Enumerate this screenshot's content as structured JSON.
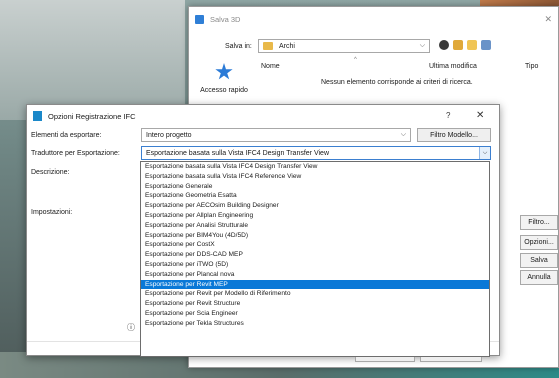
{
  "save_dialog": {
    "title": "Salva 3D",
    "save_in_label": "Salva in:",
    "save_in_value": "Archi",
    "quick_access": "Accesso rapido",
    "columns": [
      "Nome",
      "Ultima modifica",
      "Tipo"
    ],
    "empty_message": "Nessun elemento corrisponde ai criteri di ricerca.",
    "side_buttons": [
      "Filtro...",
      "Opzioni...",
      "Salva",
      "Annulla"
    ],
    "bottom_buttons": [
      "Annulla",
      "OK"
    ]
  },
  "ifc_dialog": {
    "title": "Opzioni Registrazione IFC",
    "help": "?",
    "close": "✕",
    "elements_label": "Elementi da esportare:",
    "elements_value": "Intero progetto",
    "filter_button": "Filtro Modello...",
    "translator_label": "Traduttore per Esportazione:",
    "translator_value": "Esportazione basata sulla Vista IFC4 Design Transfer View",
    "description_label": "Descrizione:",
    "settings_label": "Impostazioni:",
    "info_icon": "ⓘ"
  },
  "dropdown": {
    "selected_index": 17,
    "options": [
      "Esportazione basata sulla Vista IFC4 Design Transfer View",
      "Esportazione basata sulla Vista IFC4 Reference View",
      "Esportazione Generale",
      "Esportazione Geometria Esatta",
      "Esportazione per AECOsim Building Designer",
      "Esportazione per Allplan Engineering",
      "Esportazione per Analisi Strutturale",
      "Esportazione per BIM4You (4D/5D)",
      "Esportazione per CostX",
      "Esportazione per DDS-CAD MEP",
      "Esportazione per iTWO (5D)",
      "Esportazione per Plancal nova",
      "Esportazione per Revit MEP",
      "Esportazione per Revit per Modello di Riferimento",
      "Esportazione per Revit Structure",
      "Esportazione per Scia Engineer",
      "Esportazione per Tekla Structures"
    ]
  },
  "colors": {
    "accent": "#0a78d7",
    "folder": "#e9b94a"
  }
}
